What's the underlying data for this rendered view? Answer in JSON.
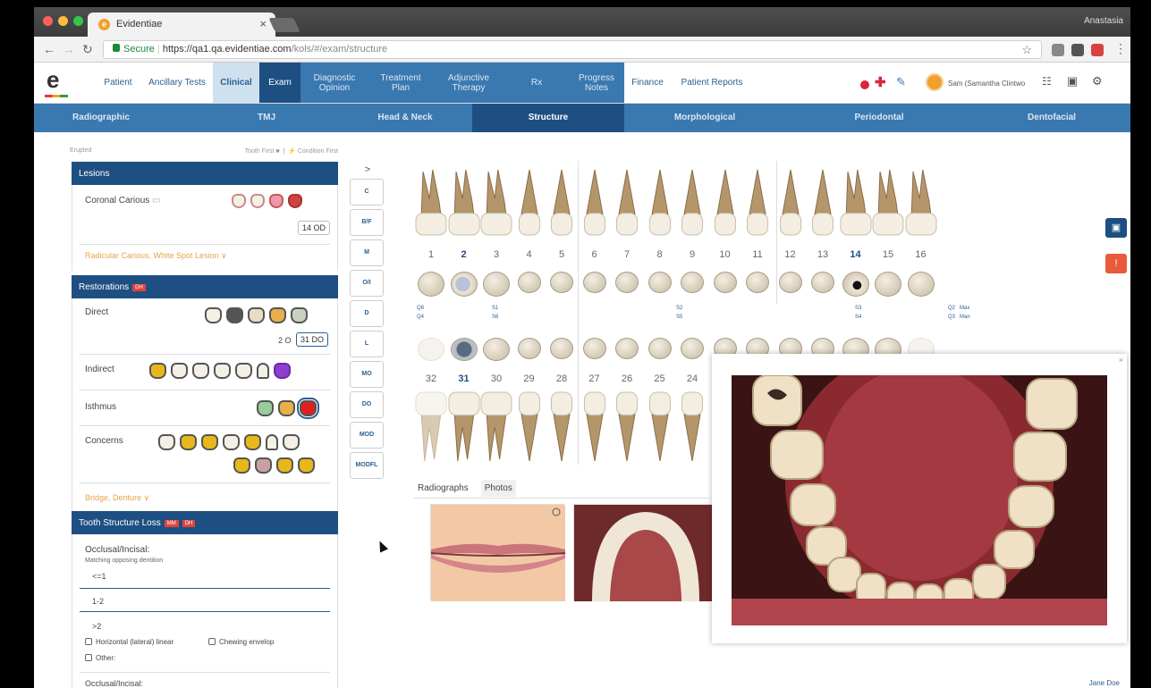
{
  "browser": {
    "tab_title": "Evidentiae",
    "tab_favicon": "e",
    "profile_name": "Anastasia",
    "url_secure": "Secure",
    "url_host": "https://qa1.qa.evidentiae.com",
    "url_path": "/kols/#/exam/structure"
  },
  "app": {
    "logo": "e",
    "nav": {
      "patient": "Patient",
      "ancillary": "Ancillary Tests",
      "clinical": "Clinical",
      "exam": "Exam",
      "diagnostic": "Diagnostic Opinion",
      "treatment": "Treatment Plan",
      "adjunctive": "Adjunctive Therapy",
      "rx": "Rx",
      "progress": "Progress Notes",
      "finance": "Finance",
      "patient_reports": "Patient Reports"
    },
    "user_name": "Sam (Samantha Clintwo",
    "subnav": [
      "Radiographic",
      "TMJ",
      "Head & Neck",
      "Structure",
      "Morphological",
      "Periodontal",
      "Dentofacial"
    ]
  },
  "left": {
    "filter_label": "Erupted",
    "sort_tooth_first": "Tooth First",
    "sort_condition_first": "Condition First",
    "lesions_title": "Lesions",
    "coronal_carious": "Coronal Carious",
    "coronal_value": "14 OD",
    "radicular_link": "Radicular Carious, White Spot Lesion",
    "restorations_title": "Restorations",
    "restorations_badge": "DH",
    "direct": "Direct",
    "direct_value_a": "2 O",
    "direct_value_b": "31 DO",
    "indirect": "Indirect",
    "isthmus": "Isthmus",
    "concerns": "Concerns",
    "bridge_link": "Bridge, Denture",
    "tsl_title": "Tooth Structure Loss",
    "tsl_badge_a": "MM",
    "tsl_badge_b": "DH",
    "occlusal": "Occlusal/Incisal:",
    "matching": "Matching opposing dentition",
    "opt1": "<=1",
    "opt2": "1-2",
    "opt3": ">2",
    "horizontal": "Horizontal (lateral) linear",
    "chewing": "Chewing envelop",
    "other": "Other:",
    "occlusal2": "Occlusal/Incisal:"
  },
  "surfaces": {
    "arrow": ">",
    "buttons": [
      "C",
      "B/F",
      "M",
      "O/I",
      "D",
      "L",
      "MO",
      "DO",
      "MOD",
      "MODFL"
    ]
  },
  "chart": {
    "upper_numbers": [
      "1",
      "2",
      "3",
      "4",
      "5",
      "6",
      "7",
      "8",
      "9",
      "10",
      "11",
      "12",
      "13",
      "14",
      "15",
      "16"
    ],
    "lower_numbers": [
      "32",
      "31",
      "30",
      "29",
      "28",
      "27",
      "26",
      "25",
      "24"
    ],
    "q_labels": {
      "q8": "Q8",
      "s1": "S1",
      "s2": "S2",
      "s3": "S3",
      "q2": "Q2",
      "max": "Max",
      "q4": "Q4",
      "s6": "S6",
      "s5": "S5",
      "s4": "S4",
      "q3": "Q3",
      "man": "Man"
    }
  },
  "photos": {
    "tab_radiographs": "Radiographs",
    "tab_photos": "Photos"
  },
  "footer_user": "Jane Doe",
  "colors": {
    "primary_dark": "#1e4f82",
    "primary": "#3a78b0",
    "accent_orange": "#e8a24a",
    "badge_red": "#e0453a"
  }
}
